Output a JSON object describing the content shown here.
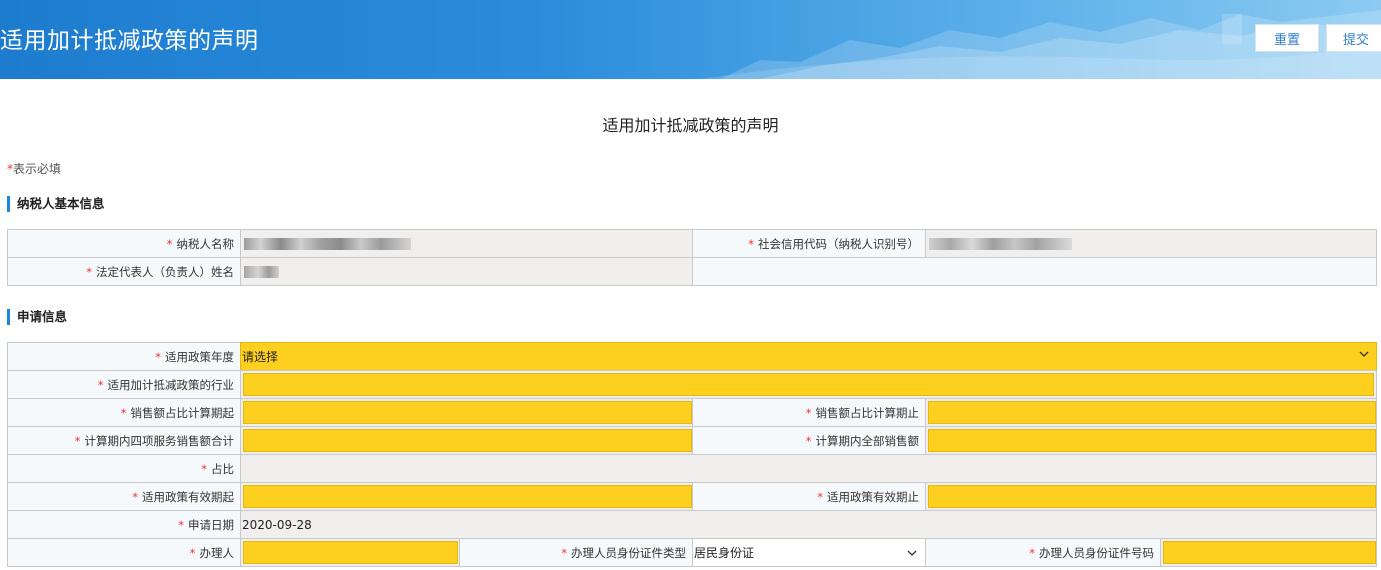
{
  "header": {
    "title": "适用加计抵减政策的声明",
    "reset_label": "重置",
    "submit_label": "提交"
  },
  "page_title": "适用加计抵减政策的声明",
  "required_note": "表示必填",
  "required_mark": "*",
  "taxpayer_section": {
    "title": "纳税人基本信息",
    "name_label": "纳税人名称",
    "credit_code_label": "社会信用代码（纳税人识别号）",
    "legal_rep_label": "法定代表人（负责人）姓名"
  },
  "application_section": {
    "title": "申请信息",
    "policy_year_label": "适用政策年度",
    "policy_year_value": "请选择",
    "industry_label": "适用加计抵减政策的行业",
    "sales_ratio_start_label": "销售额占比计算期起",
    "sales_ratio_end_label": "销售额占比计算期止",
    "four_services_sales_label": "计算期内四项服务销售额合计",
    "total_sales_label": "计算期内全部销售额",
    "ratio_label": "占比",
    "effective_start_label": "适用政策有效期起",
    "effective_end_label": "适用政策有效期止",
    "apply_date_label": "申请日期",
    "apply_date_value": "2020-09-28",
    "handler_label": "办理人",
    "id_type_label": "办理人员身份证件类型",
    "id_type_value": "居民身份证",
    "id_number_label": "办理人员身份证件号码"
  },
  "colors": {
    "banner": "#2b8ddb",
    "required_field": "#fdcf1f",
    "section_accent": "#1f86e0",
    "required_star": "#e33333"
  }
}
